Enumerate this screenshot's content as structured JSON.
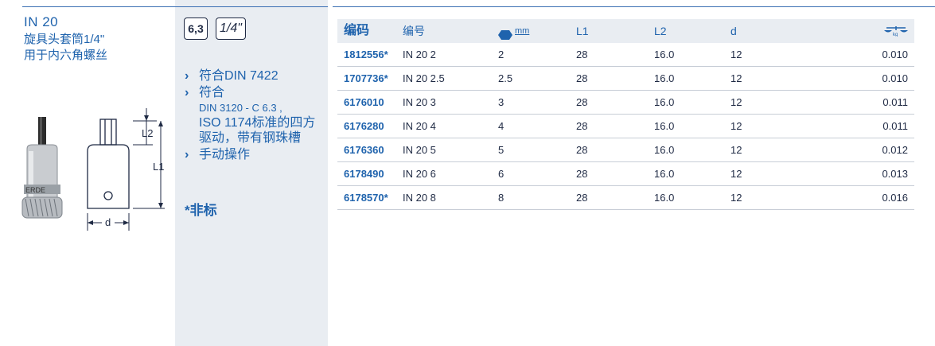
{
  "product": {
    "code": "IN 20",
    "name_line1": "旋具头套筒1/4\"",
    "name_line2": "用于内六角螺丝"
  },
  "drawing": {
    "label_l2": "L2",
    "label_l1": "L1",
    "label_d": "d"
  },
  "badges": {
    "drive": "6,3",
    "inch": "1/4\""
  },
  "features": [
    "符合DIN 7422",
    "符合",
    "DIN 3120 - C 6.3 ,",
    "ISO 1174标准的四方驱动，带有钢珠槽",
    "手动操作"
  ],
  "nonstock_note": "*非标",
  "table": {
    "headers": {
      "code": "编码",
      "model": "编号",
      "size_unit": "mm",
      "l1": "L1",
      "l2": "L2",
      "d": "d",
      "weight_unit": "kg"
    },
    "rows": [
      {
        "code": "1812556*",
        "model": "IN 20 2",
        "size": "2",
        "l1": "28",
        "l2": "16.0",
        "d": "12",
        "weight": "0.010"
      },
      {
        "code": "1707736*",
        "model": "IN 20 2.5",
        "size": "2.5",
        "l1": "28",
        "l2": "16.0",
        "d": "12",
        "weight": "0.010"
      },
      {
        "code": "6176010",
        "model": "IN 20 3",
        "size": "3",
        "l1": "28",
        "l2": "16.0",
        "d": "12",
        "weight": "0.011"
      },
      {
        "code": "6176280",
        "model": "IN 20 4",
        "size": "4",
        "l1": "28",
        "l2": "16.0",
        "d": "12",
        "weight": "0.011"
      },
      {
        "code": "6176360",
        "model": "IN 20 5",
        "size": "5",
        "l1": "28",
        "l2": "16.0",
        "d": "12",
        "weight": "0.012"
      },
      {
        "code": "6178490",
        "model": "IN 20 6",
        "size": "6",
        "l1": "28",
        "l2": "16.0",
        "d": "12",
        "weight": "0.013"
      },
      {
        "code": "6178570*",
        "model": "IN 20 8",
        "size": "8",
        "l1": "28",
        "l2": "16.0",
        "d": "12",
        "weight": "0.016"
      }
    ]
  }
}
